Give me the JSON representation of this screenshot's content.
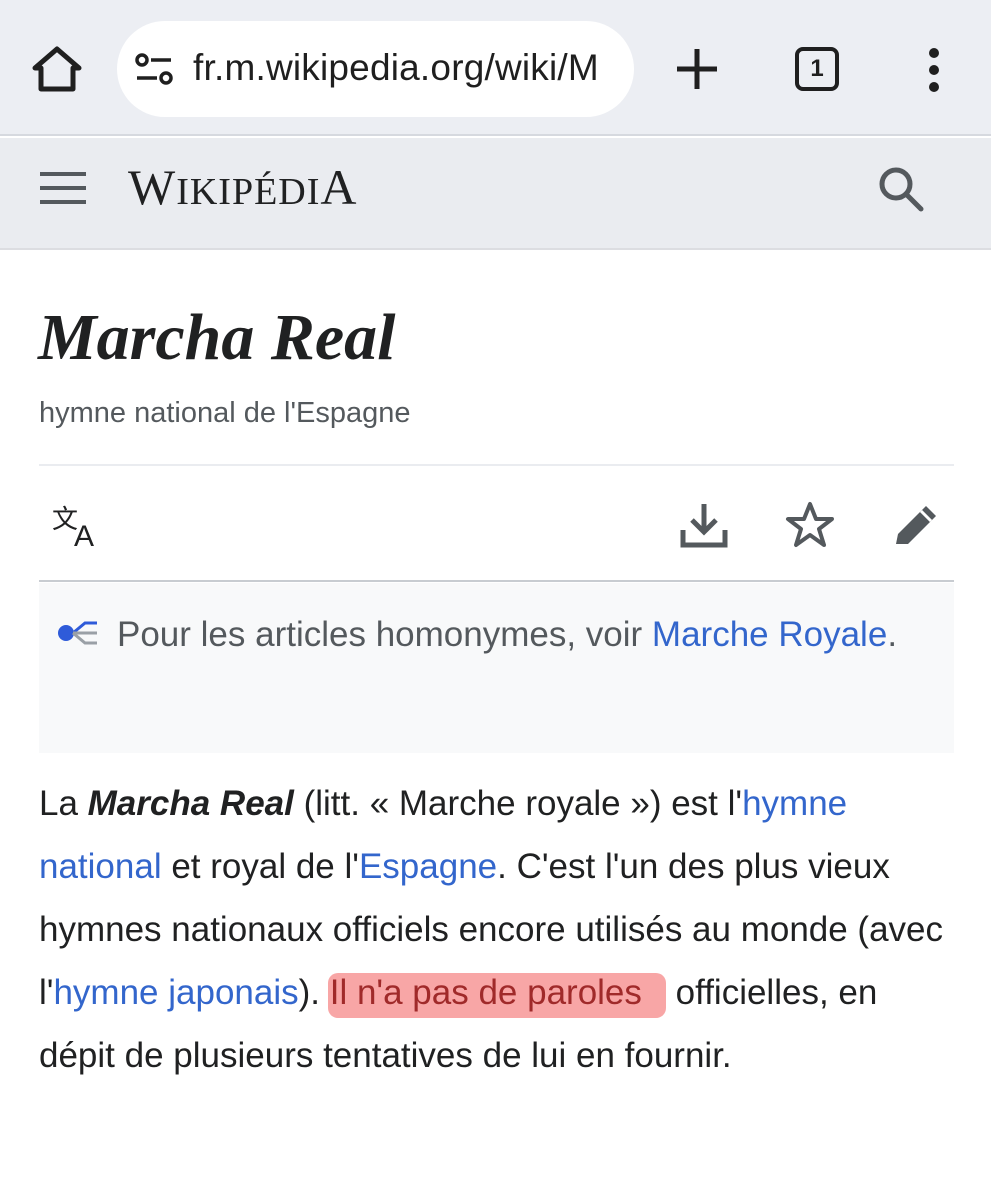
{
  "browser": {
    "url": "fr.m.wikipedia.org/wiki/M",
    "tab_count": "1"
  },
  "wiki": {
    "wordmark_w": "W",
    "wordmark_rest": "IKIPÉDI",
    "wordmark_end": "A"
  },
  "article": {
    "title": "Marcha Real",
    "subtitle": "hymne national de l'Espagne"
  },
  "hatnote": {
    "prefix": "Pour les articles homonymes, voir ",
    "link": "Marche Royale",
    "suffix": "."
  },
  "paragraph": {
    "t1": "La ",
    "bold": "Marcha Real",
    "t2": " (litt. « Marche royale ») est l'",
    "link1": "hymne national",
    "t3": " et royal de l'",
    "link2": "Espagne",
    "t4": ". C'est l'un des plus vieux hymnes nationaux officiels encore utilisés au monde (avec l'",
    "link3": "hymne japonais",
    "t5": "). ",
    "highlight": "Il n'a pas de paroles",
    "t6": " officielles, en dépit de plusieurs tentatives de lui en fournir."
  },
  "colors": {
    "link": "#3366cc",
    "highlight": "#f47070",
    "header_bg": "#eaecf0"
  }
}
